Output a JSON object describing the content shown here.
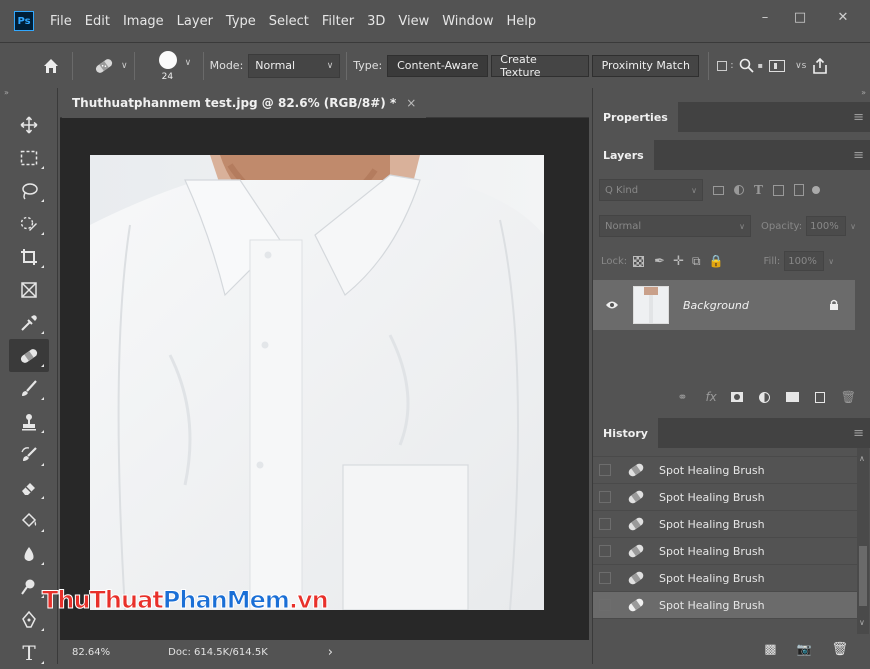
{
  "menubar": {
    "logo": "Ps",
    "items": [
      "File",
      "Edit",
      "Image",
      "Layer",
      "Type",
      "Select",
      "Filter",
      "3D",
      "View",
      "Window",
      "Help"
    ],
    "minimize": "–",
    "maximize": "□",
    "close": "✕"
  },
  "options": {
    "brush_size": "24",
    "mode_label": "Mode:",
    "mode_value": "Normal",
    "type_label": "Type:",
    "type_buttons": [
      "Content-Aware",
      "Create Texture",
      "Proximity Match"
    ]
  },
  "document": {
    "tab_title": "Thuthuatphanmem test.jpg @ 82.6% (RGB/8#) *",
    "close": "×",
    "zoom": "82.64%",
    "doc_info": "Doc: 614.5K/614.5K",
    "arrow": "›"
  },
  "watermark": {
    "part1": "ThuThuat",
    "part2": "PhanMem",
    "part3": ".vn"
  },
  "panels": {
    "properties_tab": "Properties",
    "layers_tab": "Layers",
    "kind_label": "Q Kind",
    "blend_mode": "Normal",
    "opacity_label": "Opacity:",
    "opacity_value": "100%",
    "lock_label": "Lock:",
    "fill_label": "Fill:",
    "fill_value": "100%",
    "layer_name": "Background",
    "fx_label": "fx",
    "history_tab": "History",
    "history_items": [
      "Spot Healing Brush",
      "Spot Healing Brush",
      "Spot Healing Brush",
      "Spot Healing Brush",
      "Spot Healing Brush",
      "Spot Healing Brush"
    ]
  },
  "colors": {
    "accent": "#31a8ff",
    "watermark_red": "#e8302a",
    "watermark_blue": "#1a6fd6"
  },
  "icons": {
    "home": "home-icon",
    "tools": [
      "move-icon",
      "marquee-icon",
      "lasso-icon",
      "quick-selection-icon",
      "crop-icon",
      "frame-icon",
      "eyedropper-icon",
      "spot-healing-brush-icon",
      "brush-icon",
      "clone-stamp-icon",
      "history-brush-icon",
      "eraser-icon",
      "paint-bucket-icon",
      "blur-icon",
      "dodge-icon",
      "pen-icon",
      "type-icon"
    ]
  }
}
